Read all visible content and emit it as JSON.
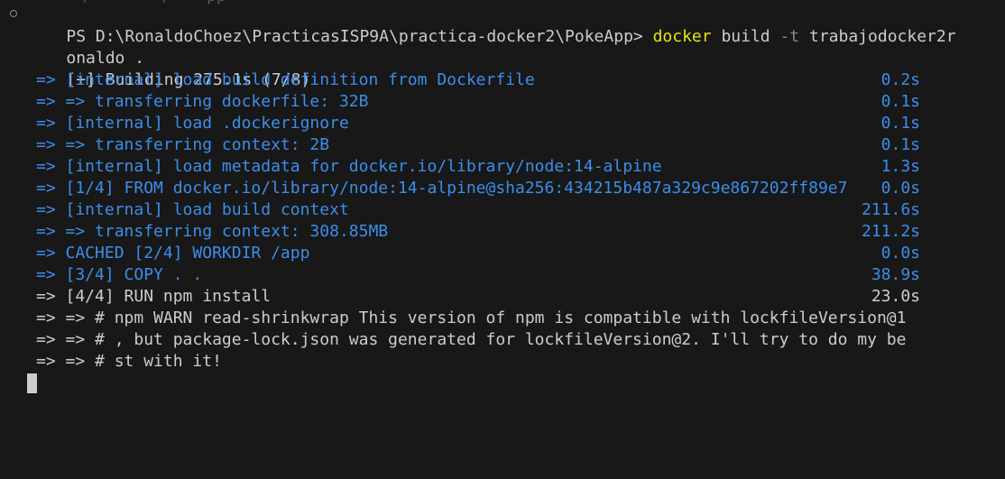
{
  "terminal": {
    "top_fragments": [
      "\\",
      "\\",
      "pp"
    ],
    "prompt_prefix": "PS D:\\RonaldoChoez\\PracticasISP9A\\practica-docker2\\PokeApp> ",
    "command_docker": "docker",
    "command_build": " build ",
    "command_flag": "-t",
    "command_rest_line1": " trabajodocker2r",
    "command_rest_line2": "onaldo .",
    "build_header": "[+] Building 275.1s (7/8)",
    "steps": [
      {
        "text": "=> [internal] load build definition from Dockerfile",
        "time": "0.2s"
      },
      {
        "text": "=> => transferring dockerfile: 32B",
        "time": "0.1s"
      },
      {
        "text": "=> [internal] load .dockerignore",
        "time": "0.1s"
      },
      {
        "text": "=> => transferring context: 2B",
        "time": "0.1s"
      },
      {
        "text": "=> [internal] load metadata for docker.io/library/node:14-alpine",
        "time": "1.3s"
      },
      {
        "text": "=> [1/4] FROM docker.io/library/node:14-alpine@sha256:434215b487a329c9e867202ff89e7",
        "time": "0.0s"
      },
      {
        "text": "=> [internal] load build context",
        "time": "211.6s"
      },
      {
        "text": "=> => transferring context: 308.85MB",
        "time": "211.2s"
      },
      {
        "text": "=> CACHED [2/4] WORKDIR /app",
        "time": "0.0s"
      },
      {
        "text": "=> [3/4] COPY . .",
        "time": "38.9s"
      },
      {
        "text": "=> [4/4] RUN npm install",
        "time": "23.0s"
      },
      {
        "text": "=> => # npm WARN read-shrinkwrap This version of npm is compatible with lockfileVersion@1",
        "time": ""
      },
      {
        "text": "=> => # , but package-lock.json was generated for lockfileVersion@2. I'll try to do my be",
        "time": ""
      },
      {
        "text": "=> => # st with it!",
        "time": ""
      }
    ],
    "colors": {
      "background": "#181818",
      "foreground": "#cccccc",
      "blue": "#3b8eea",
      "yellow": "#e5e510"
    }
  }
}
